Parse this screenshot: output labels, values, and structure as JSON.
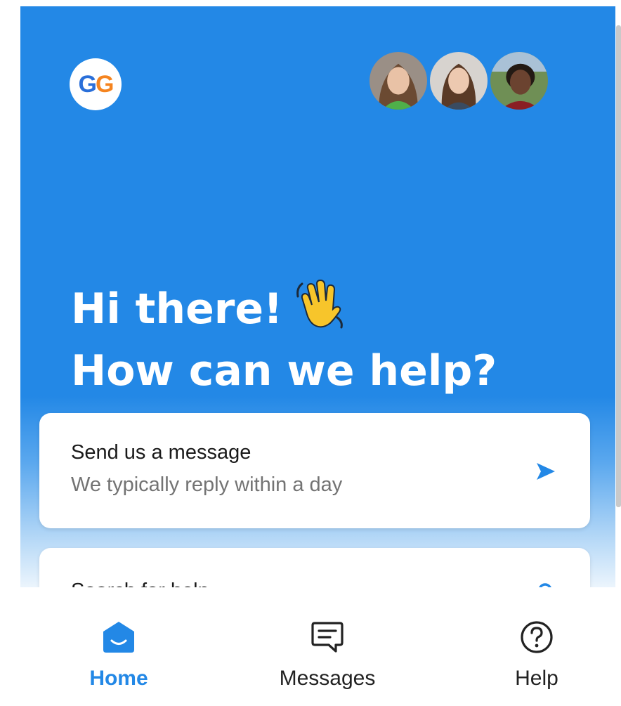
{
  "brand": {
    "logo_letter_1": "G",
    "logo_letter_2": "G"
  },
  "team_avatars": [
    {
      "name": "avatar-1"
    },
    {
      "name": "avatar-2"
    },
    {
      "name": "avatar-3"
    }
  ],
  "greeting": {
    "line1": "Hi there!",
    "line2": "How can we help?",
    "emoji": "waving-hand"
  },
  "cards": {
    "message": {
      "title": "Send us a message",
      "subtitle": "We typically reply within a day",
      "icon": "send-icon"
    },
    "search": {
      "title": "Search for help",
      "icon": "search-icon"
    }
  },
  "bottom_nav": {
    "home": {
      "label": "Home",
      "icon": "home-icon",
      "active": true
    },
    "messages": {
      "label": "Messages",
      "icon": "messages-icon"
    },
    "help": {
      "label": "Help",
      "icon": "help-icon"
    }
  },
  "colors": {
    "primary": "#2388e6",
    "logo_blue": "#2a6fd9",
    "logo_orange": "#f5841f"
  }
}
